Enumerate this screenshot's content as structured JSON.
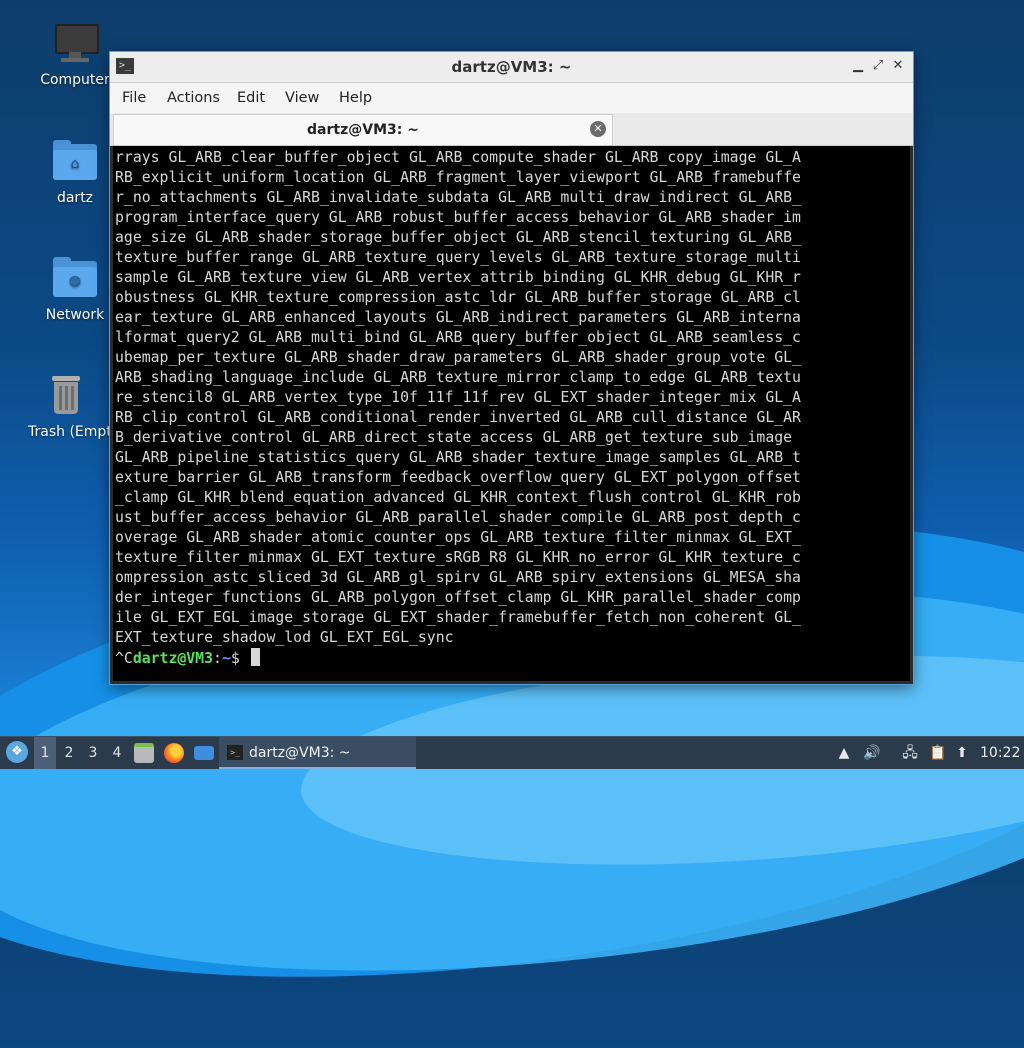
{
  "desktop": {
    "icons": [
      {
        "label": "Computer",
        "icon": "computer-icon"
      },
      {
        "label": "dartz",
        "icon": "home-folder-icon"
      },
      {
        "label": "Network",
        "icon": "network-folder-icon"
      },
      {
        "label": "Trash (Empty)",
        "icon": "trash-icon"
      }
    ]
  },
  "window": {
    "title": "dartz@VM3: ~",
    "menu": [
      "File",
      "Actions",
      "Edit",
      "View",
      "Help"
    ],
    "tab_label": "dartz@VM3: ~",
    "buttons": {
      "minimize": "▁",
      "maximize": "⤢",
      "close": "✕"
    }
  },
  "terminal": {
    "lines": [
      "rrays GL_ARB_clear_buffer_object GL_ARB_compute_shader GL_ARB_copy_image GL_A",
      "RB_explicit_uniform_location GL_ARB_fragment_layer_viewport GL_ARB_framebuffe",
      "r_no_attachments GL_ARB_invalidate_subdata GL_ARB_multi_draw_indirect GL_ARB_",
      "program_interface_query GL_ARB_robust_buffer_access_behavior GL_ARB_shader_im",
      "age_size GL_ARB_shader_storage_buffer_object GL_ARB_stencil_texturing GL_ARB_",
      "texture_buffer_range GL_ARB_texture_query_levels GL_ARB_texture_storage_multi",
      "sample GL_ARB_texture_view GL_ARB_vertex_attrib_binding GL_KHR_debug GL_KHR_r",
      "obustness GL_KHR_texture_compression_astc_ldr GL_ARB_buffer_storage GL_ARB_cl",
      "ear_texture GL_ARB_enhanced_layouts GL_ARB_indirect_parameters GL_ARB_interna",
      "lformat_query2 GL_ARB_multi_bind GL_ARB_query_buffer_object GL_ARB_seamless_c",
      "ubemap_per_texture GL_ARB_shader_draw_parameters GL_ARB_shader_group_vote GL_",
      "ARB_shading_language_include GL_ARB_texture_mirror_clamp_to_edge GL_ARB_textu",
      "re_stencil8 GL_ARB_vertex_type_10f_11f_11f_rev GL_EXT_shader_integer_mix GL_A",
      "RB_clip_control GL_ARB_conditional_render_inverted GL_ARB_cull_distance GL_AR",
      "B_derivative_control GL_ARB_direct_state_access GL_ARB_get_texture_sub_image",
      "GL_ARB_pipeline_statistics_query GL_ARB_shader_texture_image_samples GL_ARB_t",
      "exture_barrier GL_ARB_transform_feedback_overflow_query GL_EXT_polygon_offset",
      "_clamp GL_KHR_blend_equation_advanced GL_KHR_context_flush_control GL_KHR_rob",
      "ust_buffer_access_behavior GL_ARB_parallel_shader_compile GL_ARB_post_depth_c",
      "overage GL_ARB_shader_atomic_counter_ops GL_ARB_texture_filter_minmax GL_EXT_",
      "texture_filter_minmax GL_EXT_texture_sRGB_R8 GL_KHR_no_error GL_KHR_texture_c",
      "ompression_astc_sliced_3d GL_ARB_gl_spirv GL_ARB_spirv_extensions GL_MESA_sha",
      "der_integer_functions GL_ARB_polygon_offset_clamp GL_KHR_parallel_shader_comp",
      "ile GL_EXT_EGL_image_storage GL_EXT_shader_framebuffer_fetch_non_coherent GL_",
      "EXT_texture_shadow_lod GL_EXT_EGL_sync"
    ],
    "prompt": {
      "prefix": "^C",
      "user": "dartz@VM3",
      "sep": ":",
      "path": "~",
      "symbol": "$ "
    }
  },
  "taskbar": {
    "workspaces": [
      "1",
      "2",
      "3",
      "4"
    ],
    "active_workspace": "1",
    "launchers": [
      "file-manager-icon",
      "firefox-icon",
      "show-desktop-icon"
    ],
    "task_label": "dartz@VM3: ~",
    "tray_icons": [
      "removable-media-icon",
      "volume-icon",
      "network-icon",
      "clipboard-icon",
      "update-notifier-icon"
    ],
    "clock": "10:22"
  },
  "colors": {
    "prompt_user": "#57e157",
    "prompt_path": "#6a8cff",
    "terminal_bg": "#000000",
    "taskbar_bg": "#2c3b4c"
  }
}
